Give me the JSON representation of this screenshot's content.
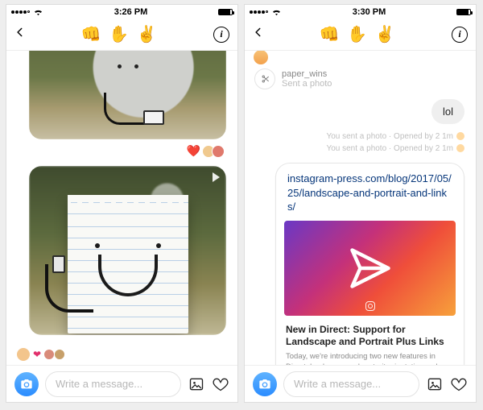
{
  "left": {
    "status": {
      "carrier_dots": 5,
      "time": "3:26 PM"
    },
    "nav": {
      "title_emojis": "👊 ✋ ✌️"
    },
    "reactions": {
      "heart": "❤️"
    },
    "composer": {
      "placeholder": "Write a message..."
    }
  },
  "right": {
    "status": {
      "carrier_dots": 5,
      "time": "3:30 PM"
    },
    "nav": {
      "title_emojis": "👊 ✋ ✌️"
    },
    "thread": {
      "username": "paper_wins",
      "subtitle": "Sent a photo"
    },
    "bubble": {
      "text": "lol"
    },
    "receipts": {
      "line1": "You sent a photo · Opened by 2",
      "line2": "You sent a photo · Opened by 2"
    },
    "link": {
      "url": "instagram-press.com/blog/2017/05/25/landscape-and-portrait-and-links/",
      "title": "New in Direct: Support for Landscape and Portrait Plus Links",
      "desc": "Today, we're introducing two new features in Direct: landscape and portrait orientations, plus links. Now, whenever you send a permanent..."
    },
    "composer": {
      "placeholder": "Write a message..."
    }
  },
  "receipt_suffix": "1m"
}
